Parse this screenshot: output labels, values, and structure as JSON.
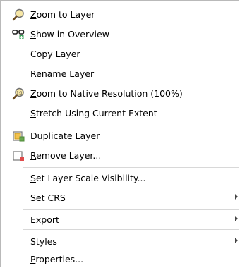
{
  "menu": {
    "items": [
      {
        "pre": "",
        "acc": "Z",
        "post": "oom to Layer"
      },
      {
        "pre": "",
        "acc": "S",
        "post": "how in Overview"
      },
      {
        "pre": "Copy Layer",
        "acc": "",
        "post": ""
      },
      {
        "pre": "Re",
        "acc": "n",
        "post": "ame Layer"
      },
      {
        "pre": "",
        "acc": "Z",
        "post": "oom to Native Resolution (100%)"
      },
      {
        "pre": "",
        "acc": "S",
        "post": "tretch Using Current Extent"
      },
      {
        "pre": "",
        "acc": "D",
        "post": "uplicate Layer"
      },
      {
        "pre": "",
        "acc": "R",
        "post": "emove Layer..."
      },
      {
        "pre": "",
        "acc": "S",
        "post": "et Layer Scale Visibility..."
      },
      {
        "pre": "Set CRS",
        "acc": "",
        "post": ""
      },
      {
        "pre": "Export",
        "acc": "",
        "post": ""
      },
      {
        "pre": "Styles",
        "acc": "",
        "post": ""
      },
      {
        "pre": "",
        "acc": "P",
        "post": "roperties..."
      }
    ],
    "icons": {
      "zoom_to_layer": "magnifier-icon",
      "show_in_overview": "glasses-icon",
      "zoom_native": "magnifier-1-1-icon",
      "duplicate": "duplicate-layer-icon",
      "remove": "remove-layer-icon"
    },
    "colors": {
      "border": "#b9b9b9",
      "separator": "#d8d8d8",
      "icon_yellow": "#f2c14e",
      "icon_red": "#e04b4b",
      "icon_green": "#3aa35a"
    }
  }
}
